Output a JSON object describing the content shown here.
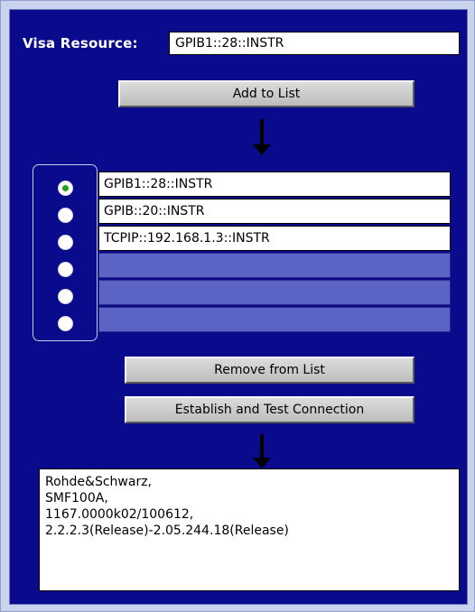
{
  "visa": {
    "label": "Visa Resource:",
    "value": "GPIB1::28::INSTR"
  },
  "buttons": {
    "add": "Add to List",
    "remove": "Remove from List",
    "establish": "Establish and Test Connection"
  },
  "resource_list": {
    "selected_index": 0,
    "items": [
      "GPIB1::28::INSTR",
      "GPIB::20::INSTR",
      "TCPIP::192.168.1.3::INSTR",
      "",
      "",
      ""
    ]
  },
  "output": {
    "lines": [
      "Rohde&Schwarz,",
      "SMF100A,",
      "1167.0000k02/100612,",
      "2.2.2.3(Release)-2.05.244.18(Release)"
    ]
  },
  "icons": {
    "arrow": "arrow-down-icon",
    "radio": "radio-button-icon"
  },
  "colors": {
    "panel_background": "#0a0a8c",
    "empty_row": "#5b63c4",
    "radio_selected_dot": "#22a022",
    "outer_frame": "#c9d3ec"
  }
}
